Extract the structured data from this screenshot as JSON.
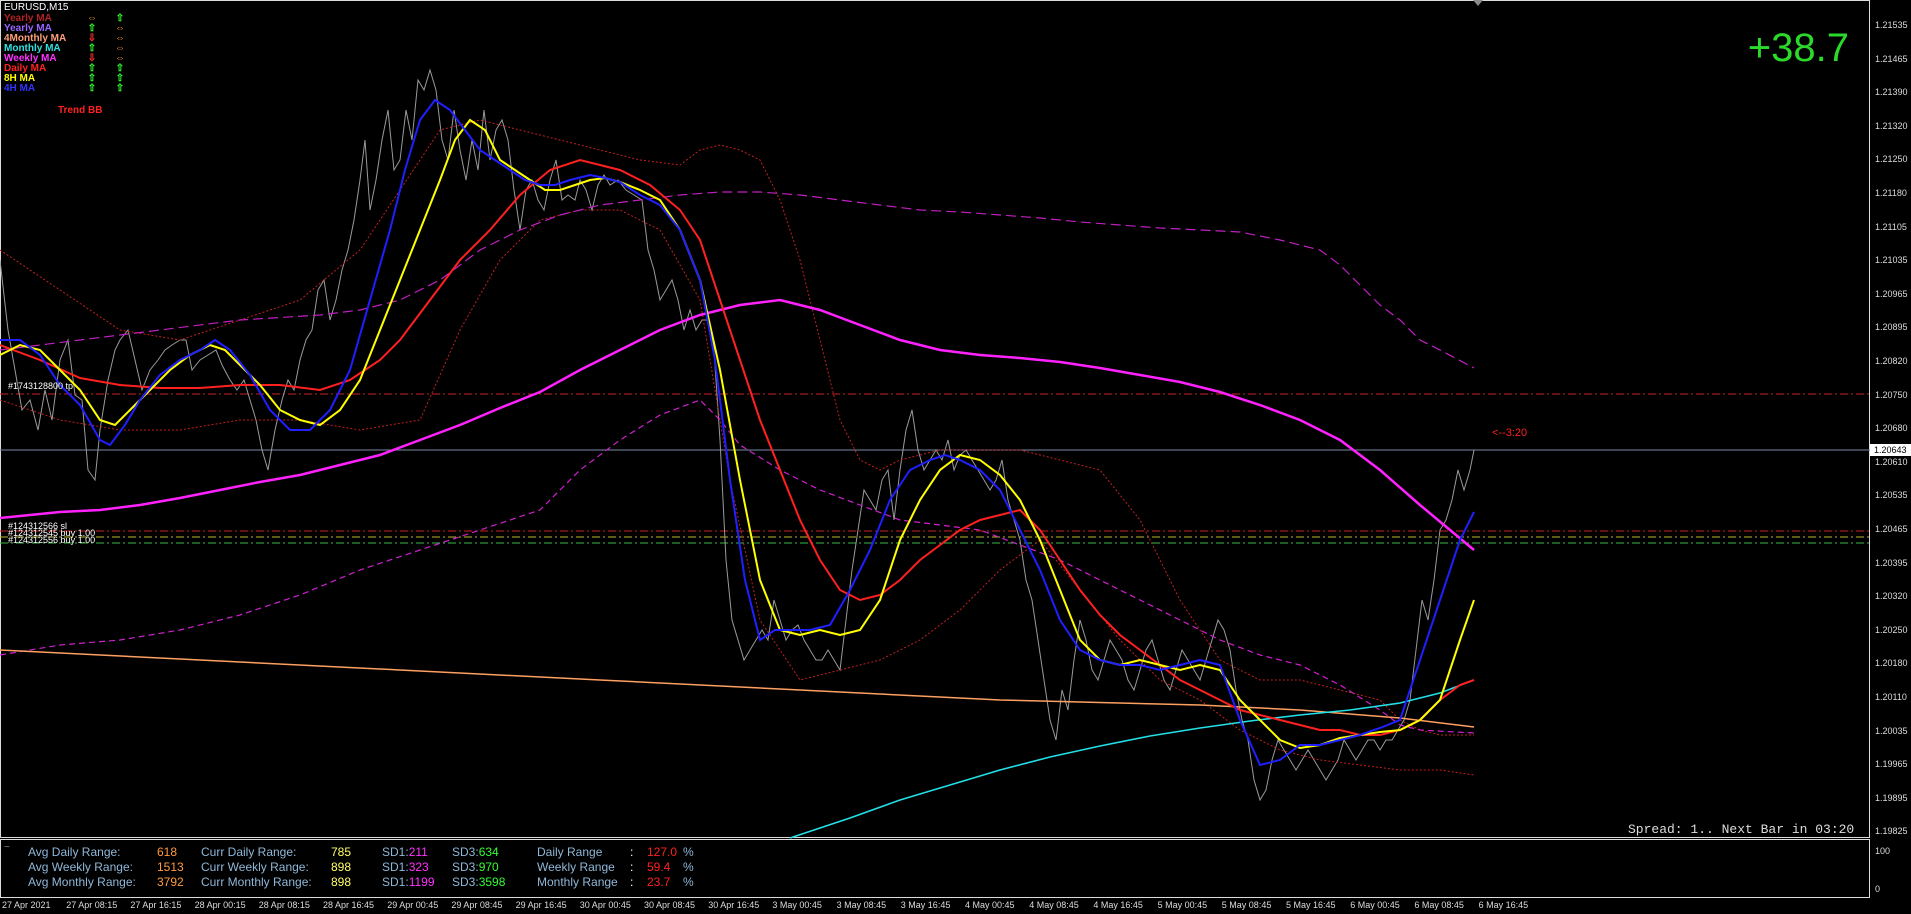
{
  "chart": {
    "symbol": "EURUSD,M15",
    "pnl": "+38.7",
    "trend_label": "Trend BB",
    "timer_label": "<--3:20",
    "spread_text": "Spread: 1.. Next Bar in 03:20",
    "current_price": "1.20643",
    "order_labels": [
      "#1743128800 tp",
      "#124312566 sl",
      "#124312545 buy 1.00",
      "#124312556 buy 1.00"
    ]
  },
  "legend": [
    {
      "name": "Yearly MA",
      "color": "#b22222",
      "arrow1": "⇔",
      "arrow1_color": "#ff9933",
      "arrow2": "⇧",
      "arrow2_color": "#33ff33"
    },
    {
      "name": "Yearly MA",
      "color": "#9966ff",
      "arrow1": "⇧",
      "arrow1_color": "#33ff33",
      "arrow2": "⇔",
      "arrow2_color": "#ff9933"
    },
    {
      "name": "4Monthly MA",
      "color": "#ffa07a",
      "arrow1": "⇩",
      "arrow1_color": "#ff3333",
      "arrow2": "⇔",
      "arrow2_color": "#ff9933"
    },
    {
      "name": "Monthly MA",
      "color": "#33e0e0",
      "arrow1": "⇧",
      "arrow1_color": "#33ff33",
      "arrow2": "⇔",
      "arrow2_color": "#ff9933"
    },
    {
      "name": "Weekly MA",
      "color": "#ff33ff",
      "arrow1": "⇩",
      "arrow1_color": "#ff3333",
      "arrow2": "⇔",
      "arrow2_color": "#ff9933"
    },
    {
      "name": "Daily MA",
      "color": "#ff2020",
      "arrow1": "⇧",
      "arrow1_color": "#33ff33",
      "arrow2": "⇧",
      "arrow2_color": "#33ff33"
    },
    {
      "name": "8H MA",
      "color": "#ffff00",
      "arrow1": "⇧",
      "arrow1_color": "#33ff33",
      "arrow2": "⇧",
      "arrow2_color": "#33ff33"
    },
    {
      "name": "4H MA",
      "color": "#3333ff",
      "arrow1": "⇧",
      "arrow1_color": "#33ff33",
      "arrow2": "⇧",
      "arrow2_color": "#33ff33"
    }
  ],
  "price_axis": [
    "1.21535",
    "1.21465",
    "1.21390",
    "1.21320",
    "1.21250",
    "1.21180",
    "1.21105",
    "1.21035",
    "1.20965",
    "1.20895",
    "1.20820",
    "1.20750",
    "1.20680",
    "1.20610",
    "1.20535",
    "1.20465",
    "1.20395",
    "1.20320",
    "1.20250",
    "1.20180",
    "1.20110",
    "1.20035",
    "1.19965",
    "1.19895",
    "1.19825"
  ],
  "time_axis": [
    "27 Apr 2021",
    "27 Apr 08:15",
    "27 Apr 16:15",
    "28 Apr 00:15",
    "28 Apr 08:15",
    "28 Apr 16:45",
    "29 Apr 00:45",
    "29 Apr 08:45",
    "29 Apr 16:45",
    "30 Apr 00:45",
    "30 Apr 08:45",
    "30 Apr 16:45",
    "3 May 00:45",
    "3 May 08:45",
    "3 May 16:45",
    "4 May 00:45",
    "4 May 08:45",
    "4 May 16:45",
    "5 May 00:45",
    "5 May 08:45",
    "5 May 16:45",
    "6 May 00:45",
    "6 May 08:45",
    "6 May 16:45"
  ],
  "sub_axis": [
    "100",
    "0"
  ],
  "stats": {
    "col1": {
      "labels": [
        "Avg Daily Range:",
        "Avg Weekly Range:",
        "Avg Monthly Range:"
      ],
      "values": [
        "618",
        "1513",
        "3792"
      ]
    },
    "col2": {
      "labels": [
        "Curr Daily Range:",
        "Curr Weekly Range:",
        "Curr Monthly Range:"
      ],
      "values": [
        "785",
        "898",
        "898"
      ]
    },
    "sd1": {
      "label": "SD1:",
      "values": [
        "211",
        "323",
        "1199"
      ]
    },
    "sd3": {
      "label": "SD3:",
      "values": [
        "634",
        "970",
        "3598"
      ]
    },
    "ranges": {
      "labels": [
        "Daily Range",
        "Weekly Range",
        "Monthly Range"
      ],
      "sep": ":",
      "values": [
        "127.0",
        "59.4",
        "23.7"
      ],
      "unit": "%"
    }
  },
  "colors": {
    "bg": "#000000",
    "grid": "#1a1a1a",
    "axis": "#dcdcdc",
    "price_line": "#7a8aa8",
    "ma_4h": "#1f1fff",
    "ma_8h": "#ffff00",
    "ma_daily": "#ff2020",
    "ma_weekly": "#ff22ff",
    "ma_monthly": "#22e0e8",
    "ma_4monthly": "#ffa060",
    "bb": "#cc2222",
    "price": "#9a9a9a"
  }
}
